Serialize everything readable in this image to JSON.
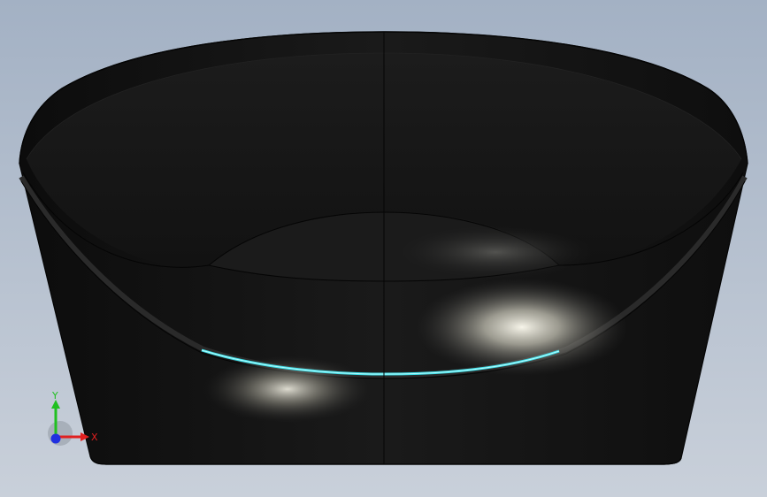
{
  "scene": {
    "model_name": "bowl-shaped-solid",
    "background_top": "#a3b1c4",
    "background_bottom": "#c9d0da",
    "model_color": "#141414",
    "highlight_edge_color": "#3fe0e8"
  },
  "triad": {
    "x_label": "X",
    "y_label": "Y",
    "x_color": "#e02020",
    "y_color": "#20c020",
    "z_color": "#2030e0"
  }
}
